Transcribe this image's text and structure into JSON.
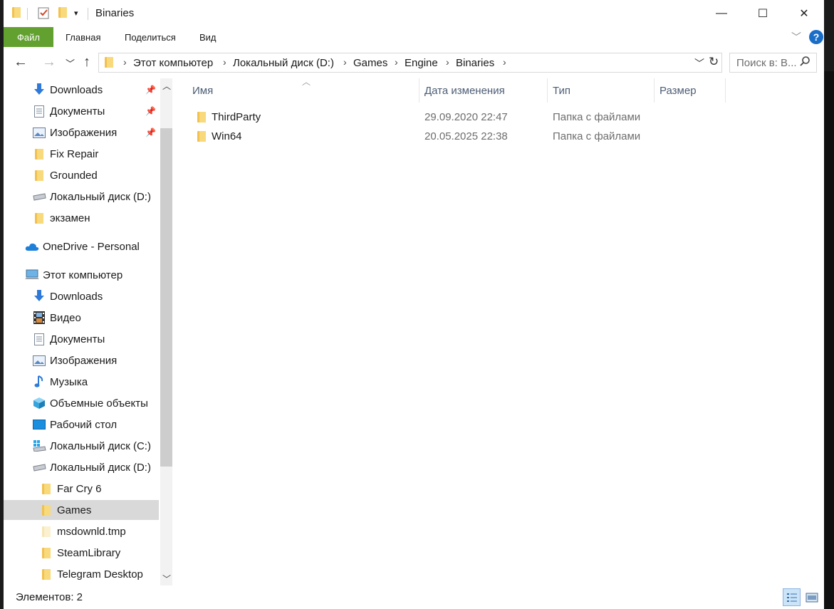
{
  "window": {
    "title": "Binaries"
  },
  "window_controls": {
    "minimize": "—",
    "maximize": "☐",
    "close": "✕"
  },
  "ribbon": {
    "tabs": [
      {
        "label": "Файл"
      },
      {
        "label": "Главная"
      },
      {
        "label": "Поделиться"
      },
      {
        "label": "Вид"
      }
    ]
  },
  "nav": {
    "breadcrumbs": [
      "Этот компьютер",
      "Локальный диск (D:)",
      "Games",
      "Engine",
      "Binaries"
    ],
    "search_placeholder": "Поиск в: В..."
  },
  "sidebar": {
    "quick_access": [
      {
        "label": "Downloads",
        "icon": "download-arrow-icon",
        "pinned": true
      },
      {
        "label": "Документы",
        "icon": "document-icon",
        "pinned": true
      },
      {
        "label": "Изображения",
        "icon": "pictures-icon",
        "pinned": true
      },
      {
        "label": "Fix Repair",
        "icon": "folder-icon"
      },
      {
        "label": "Grounded",
        "icon": "folder-icon"
      },
      {
        "label": "Локальный диск (D:)",
        "icon": "drive-icon"
      },
      {
        "label": "экзамен",
        "icon": "folder-icon"
      }
    ],
    "onedrive": {
      "label": "OneDrive - Personal",
      "icon": "cloud-icon"
    },
    "this_pc": {
      "label": "Этот компьютер",
      "icon": "computer-icon"
    },
    "pc_items": [
      {
        "label": "Downloads",
        "icon": "download-arrow-icon"
      },
      {
        "label": "Видео",
        "icon": "video-icon"
      },
      {
        "label": "Документы",
        "icon": "document-icon"
      },
      {
        "label": "Изображения",
        "icon": "pictures-icon"
      },
      {
        "label": "Музыка",
        "icon": "music-icon"
      },
      {
        "label": "Объемные объекты",
        "icon": "3d-objects-icon"
      },
      {
        "label": "Рабочий стол",
        "icon": "desktop-icon"
      },
      {
        "label": "Локальный диск (C:)",
        "icon": "windows-drive-icon"
      },
      {
        "label": "Локальный диск (D:)",
        "icon": "drive-icon"
      }
    ],
    "d_children": [
      {
        "label": "Far Cry 6",
        "icon": "folder-icon"
      },
      {
        "label": "Games",
        "icon": "folder-icon",
        "selected": true
      },
      {
        "label": "msdownld.tmp",
        "icon": "folder-icon"
      },
      {
        "label": "SteamLibrary",
        "icon": "folder-icon"
      },
      {
        "label": "Telegram Desktop",
        "icon": "folder-icon"
      }
    ]
  },
  "content": {
    "columns": [
      "Имя",
      "Дата изменения",
      "Тип",
      "Размер"
    ],
    "rows": [
      {
        "name": "ThirdParty",
        "date": "29.09.2020 22:47",
        "type": "Папка с файлами",
        "size": ""
      },
      {
        "name": "Win64",
        "date": "20.05.2025 22:38",
        "type": "Папка с файлами",
        "size": ""
      }
    ]
  },
  "status": {
    "items_count": "Элементов: 2"
  },
  "colors": {
    "file_tab": "#62a130",
    "selection": "#d9d9d9",
    "accent": "#1a6ec8",
    "folder": "#f2c14e"
  }
}
